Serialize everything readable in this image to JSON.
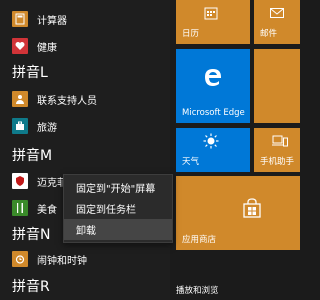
{
  "colors": {
    "tile_orange": "#d0892b",
    "tile_blue": "#0078d7",
    "menu_bg": "#2b2b2b",
    "menu_hover": "#454545"
  },
  "app_list": {
    "calculator": {
      "label": "计算器",
      "icon": "calculator-icon",
      "color": "#d0892b"
    },
    "health": {
      "label": "健康",
      "icon": "heart-icon",
      "color": "#d13438"
    },
    "section_l": "拼音L",
    "contact_support": {
      "label": "联系支持人员",
      "icon": "person-icon",
      "color": "#d0892b"
    },
    "travel": {
      "label": "旅游",
      "icon": "suitcase-icon",
      "color": "#0f7a8a"
    },
    "section_m": "拼音M",
    "mcafee": {
      "label": "迈克菲",
      "icon": "shield-icon",
      "color": "#ffffff"
    },
    "food": {
      "label": "美食",
      "icon": "fork-knife-icon",
      "color": "#3a8a2a"
    },
    "section_n": "拼音N",
    "alarms": {
      "label": "闹钟和时钟",
      "icon": "alarm-clock-icon",
      "color": "#d0892b"
    },
    "section_r": "拼音R"
  },
  "tiles": {
    "calendar": {
      "label": "日历",
      "icon": "calendar-icon"
    },
    "mail": {
      "label": "邮件",
      "icon": "mail-icon"
    },
    "edge": {
      "label": "Microsoft Edge",
      "icon": "edge-icon"
    },
    "weather": {
      "label": "天气",
      "icon": "sun-icon"
    },
    "phone": {
      "label": "手机助手",
      "icon": "phone-laptop-icon"
    },
    "store": {
      "label": "应用商店",
      "icon": "store-bag-icon"
    },
    "media": {
      "label": "播放和浏览"
    }
  },
  "context_menu": {
    "pin_start": "固定到\"开始\"屏幕",
    "pin_taskbar": "固定到任务栏",
    "uninstall": "卸载"
  }
}
